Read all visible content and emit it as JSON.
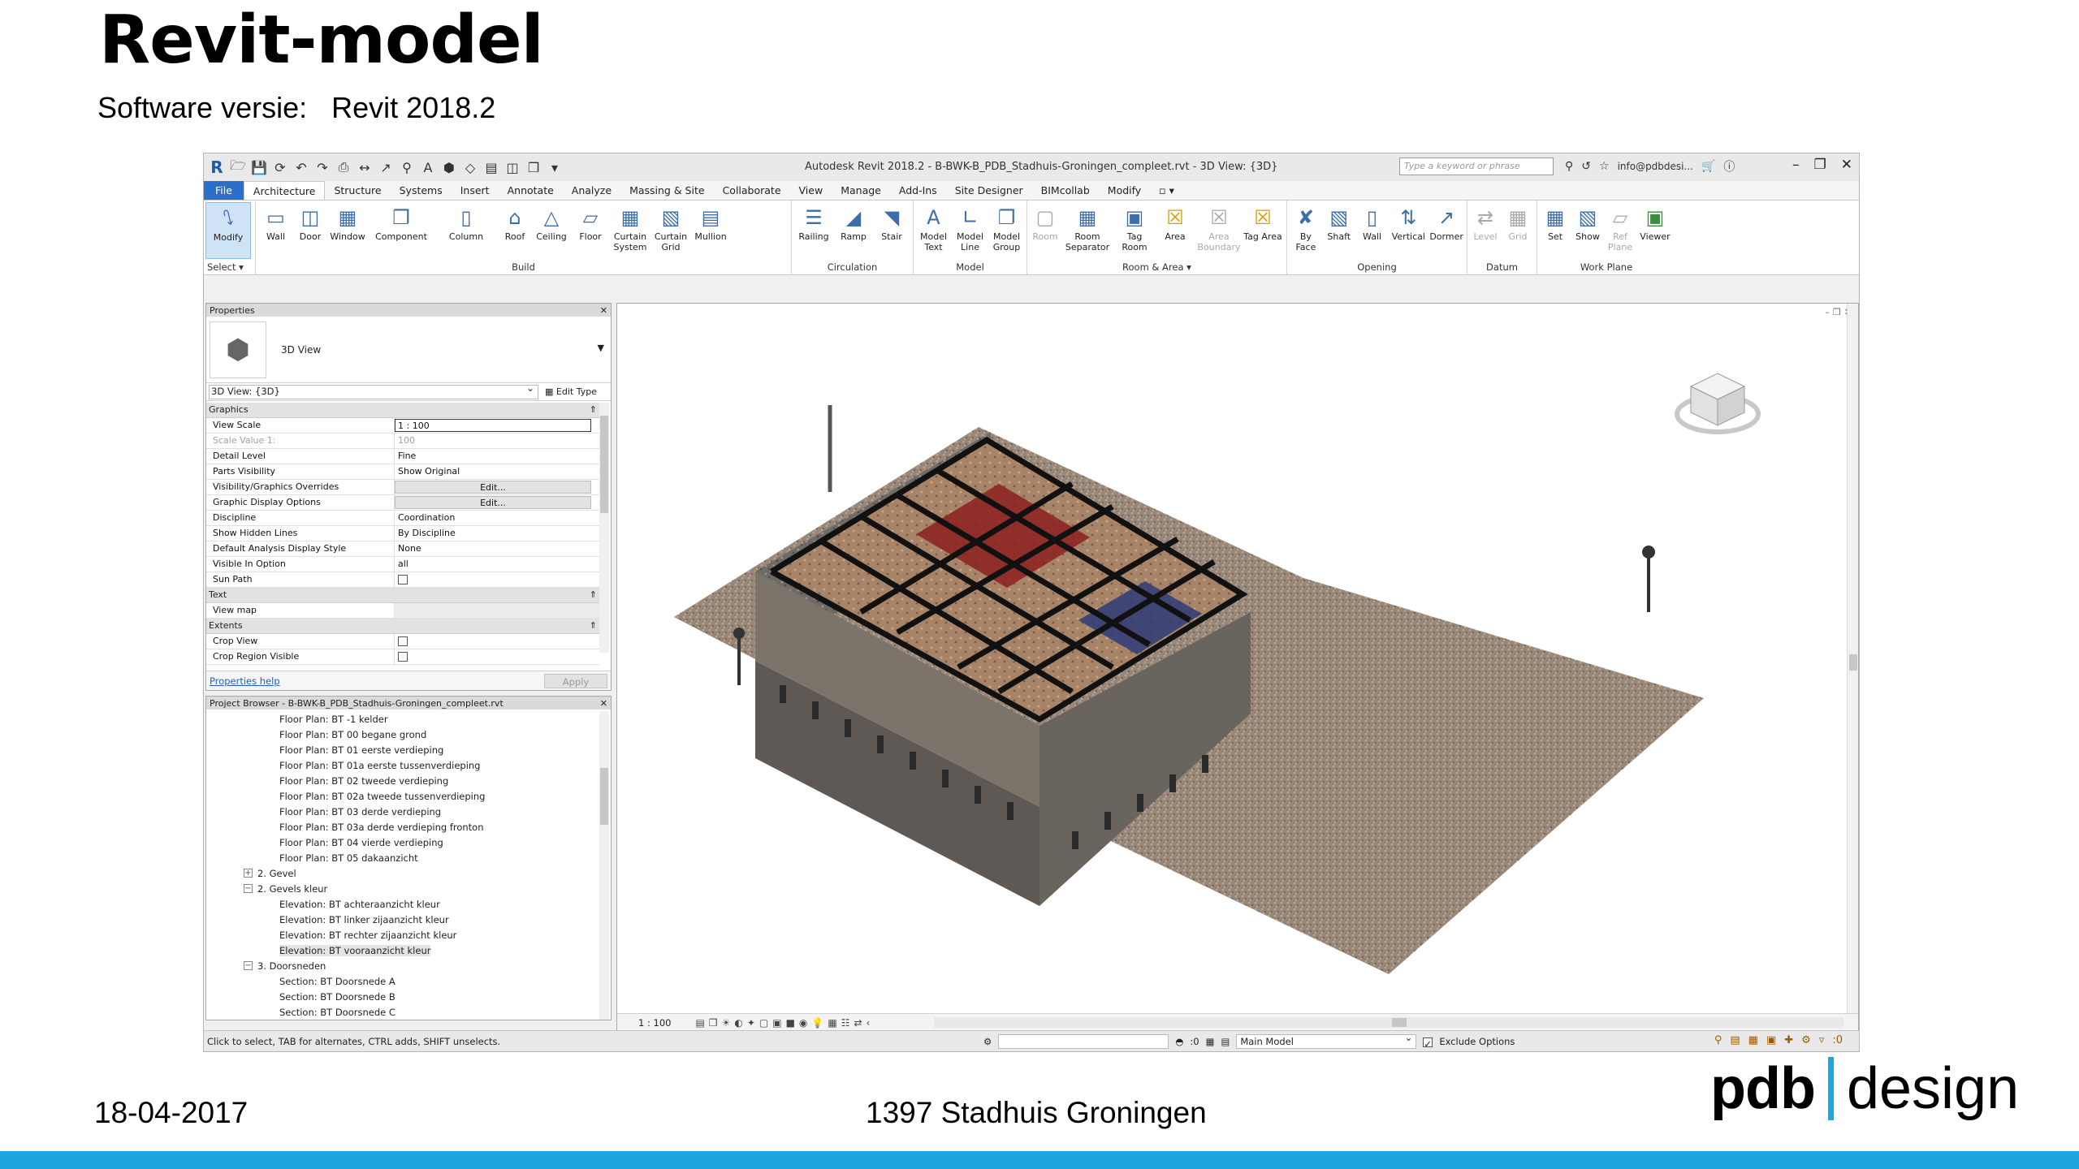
{
  "slide": {
    "title": "Revit-model",
    "subtitle": "Software versie:   Revit 2018.2",
    "footer_date": "18-04-2017",
    "footer_project": "1397 Stadhuis Groningen",
    "logo_left": "pdb",
    "logo_right": "design",
    "accent_color": "#1aa7e0"
  },
  "revit": {
    "window_title": "Autodesk Revit 2018.2 -    B-BWK-B_PDB_Stadhuis-Groningen_compleet.rvt - 3D View: {3D}",
    "search_placeholder": "Type a keyword or phrase",
    "user": "info@pdbdesi...",
    "tabs": [
      "File",
      "Architecture",
      "Structure",
      "Systems",
      "Insert",
      "Annotate",
      "Analyze",
      "Massing & Site",
      "Collaborate",
      "View",
      "Manage",
      "Add-Ins",
      "Site Designer",
      "BIMcollab",
      "Modify"
    ],
    "ribbon": {
      "select": {
        "label": "Select ▾",
        "buttons": [
          {
            "label": "Modify",
            "icon": "cursor-icon"
          }
        ]
      },
      "build": {
        "label": "Build",
        "buttons": [
          {
            "label": "Wall",
            "icon": "wall-icon"
          },
          {
            "label": "Door",
            "icon": "door-icon"
          },
          {
            "label": "Window",
            "icon": "window-icon"
          },
          {
            "label": "Component",
            "icon": "component-icon"
          },
          {
            "label": "Column",
            "icon": "column-icon"
          },
          {
            "label": "Roof",
            "icon": "roof-icon"
          },
          {
            "label": "Ceiling",
            "icon": "ceiling-icon"
          },
          {
            "label": "Floor",
            "icon": "floor-icon"
          },
          {
            "label": "Curtain System",
            "icon": "curtain-system-icon"
          },
          {
            "label": "Curtain Grid",
            "icon": "curtain-grid-icon"
          },
          {
            "label": "Mullion",
            "icon": "mullion-icon"
          }
        ]
      },
      "circulation": {
        "label": "Circulation",
        "buttons": [
          {
            "label": "Railing",
            "icon": "railing-icon"
          },
          {
            "label": "Ramp",
            "icon": "ramp-icon"
          },
          {
            "label": "Stair",
            "icon": "stair-icon"
          }
        ]
      },
      "model": {
        "label": "Model",
        "buttons": [
          {
            "label": "Model Text",
            "icon": "model-text-icon"
          },
          {
            "label": "Model Line",
            "icon": "model-line-icon"
          },
          {
            "label": "Model Group",
            "icon": "model-group-icon"
          }
        ]
      },
      "room_area": {
        "label": "Room & Area ▾",
        "buttons": [
          {
            "label": "Room",
            "icon": "room-icon"
          },
          {
            "label": "Room Separator",
            "icon": "room-separator-icon"
          },
          {
            "label": "Tag Room",
            "icon": "tag-room-icon"
          },
          {
            "label": "Area",
            "icon": "area-icon"
          },
          {
            "label": "Area Boundary",
            "icon": "area-boundary-icon"
          },
          {
            "label": "Tag Area",
            "icon": "tag-area-icon"
          }
        ]
      },
      "opening": {
        "label": "Opening",
        "buttons": [
          {
            "label": "By Face",
            "icon": "by-face-icon"
          },
          {
            "label": "Shaft",
            "icon": "shaft-icon"
          },
          {
            "label": "Wall",
            "icon": "wall-opening-icon"
          },
          {
            "label": "Vertical",
            "icon": "vertical-opening-icon"
          },
          {
            "label": "Dormer",
            "icon": "dormer-icon"
          }
        ]
      },
      "datum": {
        "label": "Datum",
        "buttons": [
          {
            "label": "Level",
            "icon": "level-icon"
          },
          {
            "label": "Grid",
            "icon": "grid-icon"
          }
        ]
      },
      "work_plane": {
        "label": "Work Plane",
        "buttons": [
          {
            "label": "Set",
            "icon": "set-icon"
          },
          {
            "label": "Show",
            "icon": "show-icon"
          },
          {
            "label": "Ref Plane",
            "icon": "ref-plane-icon"
          },
          {
            "label": "Viewer",
            "icon": "viewer-icon"
          }
        ]
      }
    },
    "properties": {
      "title": "Properties",
      "type_name": "3D View",
      "instance": "3D View: {3D}",
      "edit_type": "Edit Type",
      "groups": {
        "graphics": "Graphics",
        "text": "Text",
        "extents": "Extents"
      },
      "rows": {
        "view_scale": {
          "name": "View Scale",
          "value": "1 : 100"
        },
        "scale_value": {
          "name": "Scale Value    1:",
          "value": "100"
        },
        "detail_level": {
          "name": "Detail Level",
          "value": "Fine"
        },
        "parts_visibility": {
          "name": "Parts Visibility",
          "value": "Show Original"
        },
        "vg_overrides": {
          "name": "Visibility/Graphics Overrides",
          "value": "Edit..."
        },
        "graphic_display": {
          "name": "Graphic Display Options",
          "value": "Edit..."
        },
        "discipline": {
          "name": "Discipline",
          "value": "Coordination"
        },
        "hidden_lines": {
          "name": "Show Hidden Lines",
          "value": "By Discipline"
        },
        "analysis_style": {
          "name": "Default Analysis Display Style",
          "value": "None"
        },
        "visible_in_option": {
          "name": "Visible In Option",
          "value": "all"
        },
        "sun_path": {
          "name": "Sun Path",
          "value": ""
        },
        "view_map": {
          "name": "View map",
          "value": ""
        },
        "crop_view": {
          "name": "Crop View",
          "value": ""
        },
        "crop_region_visible": {
          "name": "Crop Region Visible",
          "value": ""
        }
      },
      "help_link": "Properties help",
      "apply": "Apply"
    },
    "browser": {
      "title": "Project Browser - B-BWK-B_PDB_Stadhuis-Groningen_compleet.rvt",
      "items": [
        "Floor Plan: BT -1 kelder",
        "Floor Plan: BT 00 begane grond",
        "Floor Plan: BT 01 eerste verdieping",
        "Floor Plan: BT 01a eerste tussenverdieping",
        "Floor Plan: BT 02 tweede verdieping",
        "Floor Plan: BT 02a tweede tussenverdieping",
        "Floor Plan: BT 03 derde verdieping",
        "Floor Plan: BT 03a derde verdieping fronton",
        "Floor Plan: BT 04 vierde verdieping",
        "Floor Plan: BT 05 dakaanzicht",
        "2. Gevel",
        "2. Gevels kleur",
        "Elevation: BT achteraanzicht kleur",
        "Elevation: BT linker zijaanzicht kleur",
        "Elevation: BT rechter zijaanzicht kleur",
        "Elevation: BT vooraanzicht kleur",
        "3. Doorsneden",
        "Section: BT Doorsnede A",
        "Section: BT Doorsnede B",
        "Section: BT Doorsnede C"
      ]
    },
    "viewport": {
      "scale": "1 : 100"
    },
    "status": {
      "hint": "Click to select, TAB for alternates, CTRL adds, SHIFT unselects.",
      "zero": ":0",
      "model": "Main Model",
      "exclude_options": "Exclude Options",
      "filter_count": ":0"
    }
  }
}
